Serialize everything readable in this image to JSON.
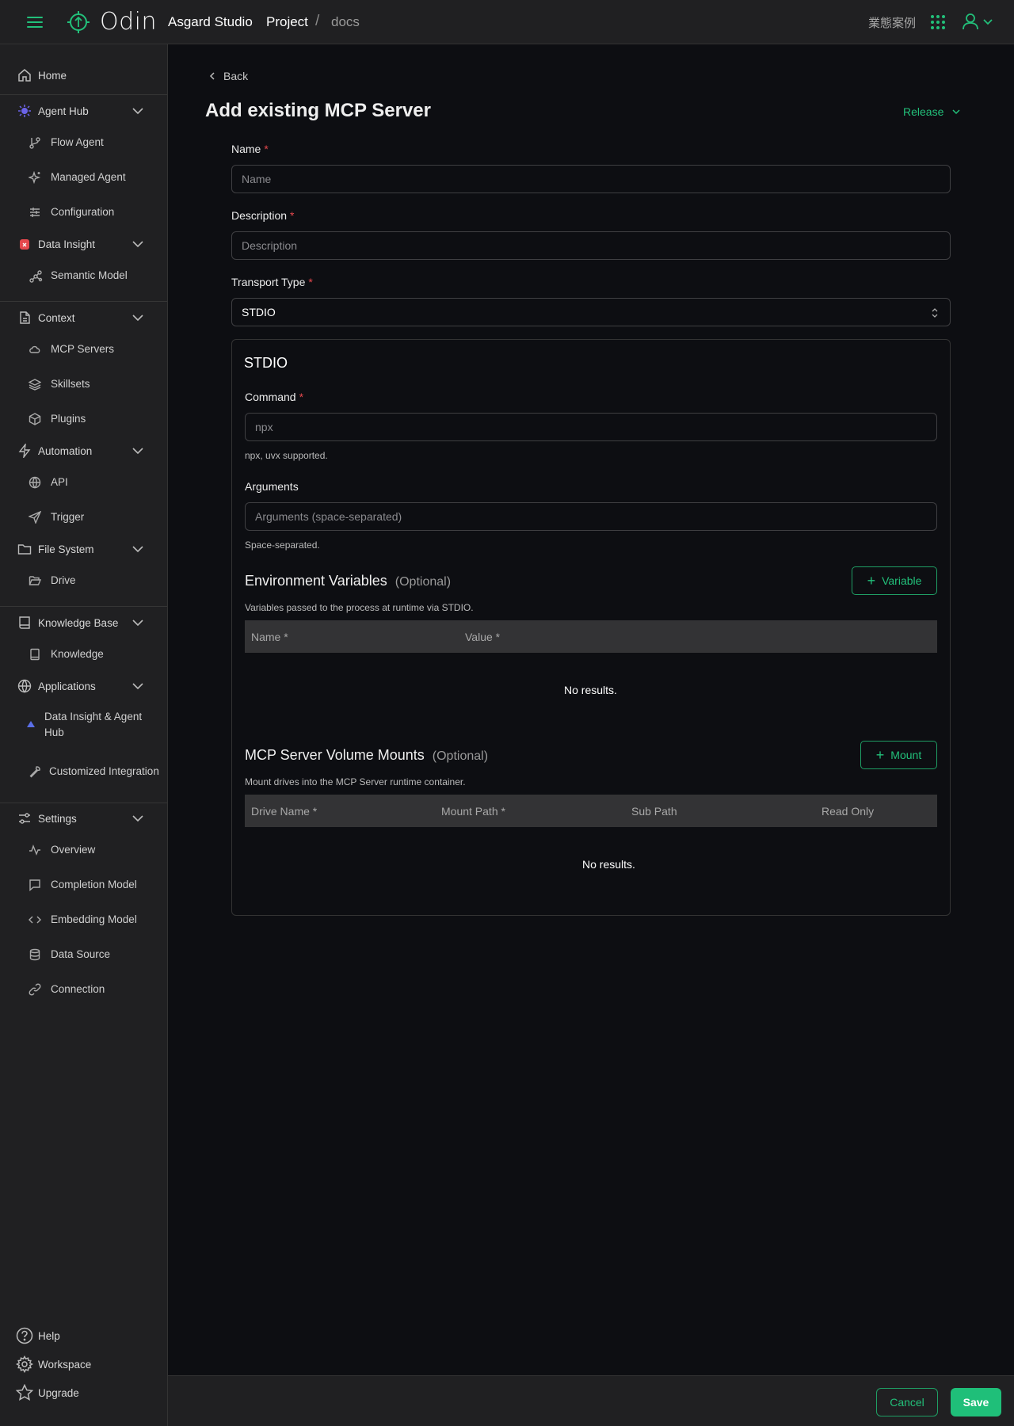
{
  "header": {
    "brand": "Odin",
    "studio": "Asgard Studio",
    "breadcrumb": {
      "project": "Project",
      "separator": "/",
      "current": "docs"
    },
    "language": "業態案例",
    "icons": [
      "menu-icon",
      "odin-logo-icon",
      "apps-grid-icon",
      "user-icon",
      "chevron-down-icon"
    ]
  },
  "sidebar": {
    "home": "Home",
    "agent_hub": {
      "label": "Agent Hub",
      "items": [
        "Flow Agent",
        "Managed Agent",
        "Configuration"
      ]
    },
    "data_insight": {
      "label": "Data Insight",
      "items": [
        "Semantic Model"
      ]
    },
    "context": {
      "label": "Context",
      "items": [
        "MCP Servers",
        "Skillsets",
        "Plugins"
      ]
    },
    "automation": {
      "label": "Automation",
      "items": [
        "API",
        "Trigger"
      ]
    },
    "file_system": {
      "label": "File System",
      "items": [
        "Drive"
      ]
    },
    "knowledge_base": {
      "label": "Knowledge Base",
      "items": [
        "Knowledge"
      ]
    },
    "applications": {
      "label": "Applications",
      "items": [
        "Data Insight & Agent Hub",
        "Customized Integration"
      ]
    },
    "settings": {
      "label": "Settings",
      "items": [
        "Overview",
        "Completion Model",
        "Embedding Model",
        "Data Source",
        "Connection"
      ]
    },
    "bottom": [
      "Help",
      "Workspace",
      "Upgrade"
    ]
  },
  "page": {
    "back": "Back",
    "title": "Add existing MCP Server",
    "release": "Release"
  },
  "form": {
    "required_mark": "*",
    "name": {
      "label": "Name",
      "placeholder": "Name",
      "value": ""
    },
    "description": {
      "label": "Description",
      "placeholder": "Description",
      "value": ""
    },
    "transport_type": {
      "label": "Transport Type",
      "value": "STDIO"
    },
    "stdio": {
      "title": "STDIO",
      "command": {
        "label": "Command",
        "placeholder": "npx",
        "value": "",
        "hint": "npx, uvx supported."
      },
      "arguments": {
        "label": "Arguments",
        "placeholder": "Arguments (space-separated)",
        "value": "",
        "hint": "Space-separated."
      }
    },
    "env_vars": {
      "title": "Environment Variables",
      "optional": "(Optional)",
      "description": "Variables passed to the process at runtime via STDIO.",
      "add_button": "Variable",
      "columns": [
        "Name *",
        "Value *"
      ],
      "rows": [],
      "empty": "No results."
    },
    "volume_mounts": {
      "title": "MCP Server Volume Mounts",
      "optional": "(Optional)",
      "description": "Mount drives into the MCP Server runtime container.",
      "add_button": "Mount",
      "columns": [
        "Drive Name *",
        "Mount Path *",
        "Sub Path",
        "Read Only"
      ],
      "rows": [],
      "empty": "No results."
    }
  },
  "footer": {
    "cancel": "Cancel",
    "save": "Save"
  },
  "colors": {
    "accent": "#22c07a",
    "background": "#0d0e12",
    "panel": "#202022",
    "required": "#e5484d"
  }
}
